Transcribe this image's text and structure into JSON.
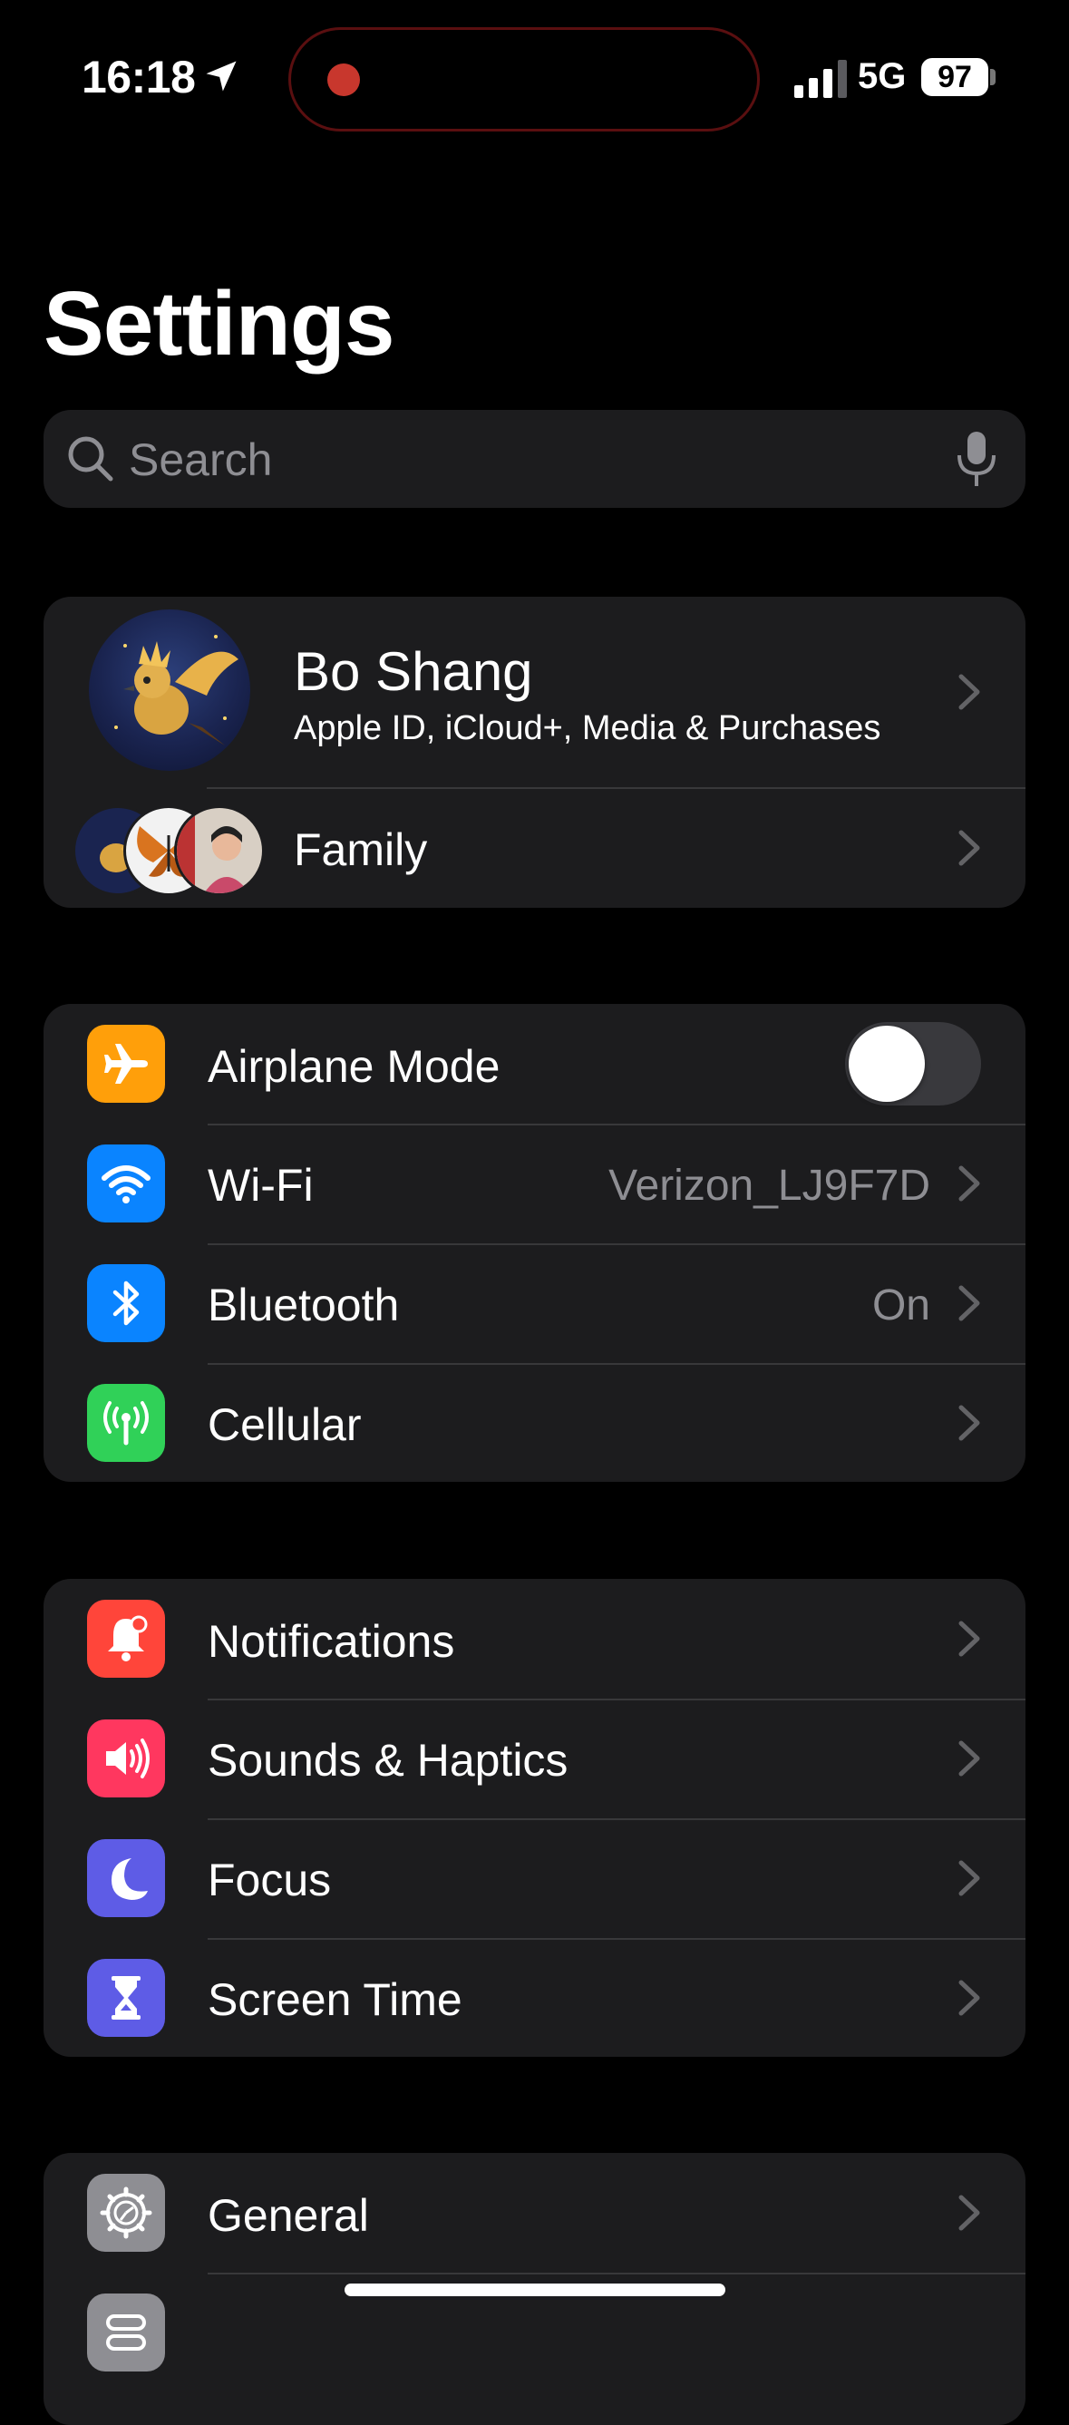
{
  "status_bar": {
    "time": "16:18",
    "network": "5G",
    "battery": "97"
  },
  "page": {
    "title": "Settings"
  },
  "search": {
    "placeholder": "Search"
  },
  "account": {
    "name": "Bo Shang",
    "subtitle": "Apple ID, iCloud+, Media & Purchases",
    "family_label": "Family"
  },
  "connectivity": {
    "airplane": {
      "label": "Airplane Mode",
      "enabled": false,
      "icon": "airplane-icon",
      "color": "#ff9f0a"
    },
    "wifi": {
      "label": "Wi-Fi",
      "value": "Verizon_LJ9F7D",
      "icon": "wifi-icon",
      "color": "#0a84ff"
    },
    "bluetooth": {
      "label": "Bluetooth",
      "value": "On",
      "icon": "bluetooth-icon",
      "color": "#0a84ff"
    },
    "cellular": {
      "label": "Cellular",
      "icon": "cellular-antenna-icon",
      "color": "#30d158"
    }
  },
  "alerts": {
    "notifications": {
      "label": "Notifications",
      "icon": "bell-icon",
      "color": "#ff453a"
    },
    "sounds": {
      "label": "Sounds & Haptics",
      "icon": "speaker-icon",
      "color": "#ff375f"
    },
    "focus": {
      "label": "Focus",
      "icon": "moon-icon",
      "color": "#5e5ce6"
    },
    "screen_time": {
      "label": "Screen Time",
      "icon": "hourglass-icon",
      "color": "#5e5ce6"
    }
  },
  "system": {
    "general": {
      "label": "General",
      "icon": "gear-icon",
      "color": "#8e8e93"
    },
    "control_center": {
      "icon": "control-center-icon",
      "color": "#8e8e93"
    }
  }
}
